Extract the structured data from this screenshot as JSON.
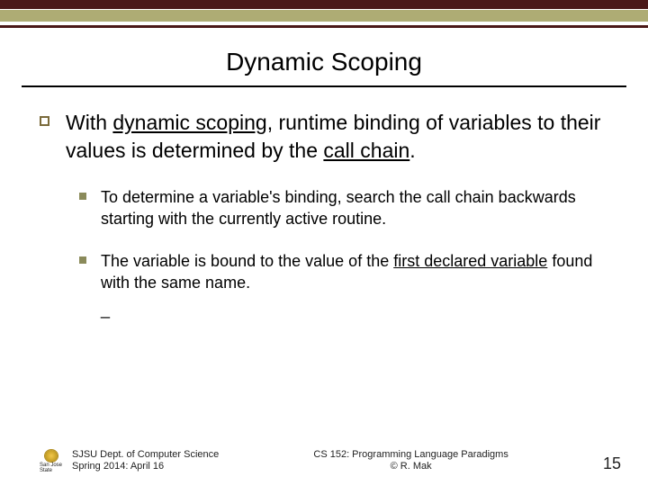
{
  "title": "Dynamic Scoping",
  "bullets": {
    "main": {
      "pre": "With ",
      "u1": "dynamic scoping",
      "mid": ", runtime binding of variables to their values is determined by the ",
      "u2": "call chain",
      "post": "."
    },
    "sub1": "To determine a variable's binding, search the call chain backwards starting with the currently active routine.",
    "sub2": {
      "pre": "The variable is bound to the value of the ",
      "u": "first declared variable",
      "post": " found with the same name.",
      "trail": "_"
    }
  },
  "footer": {
    "logo_text": "San Jose State",
    "left_line1": "SJSU Dept. of Computer Science",
    "left_line2": "Spring 2014: April 16",
    "center_line1": "CS 152: Programming Language Paradigms",
    "center_line2": "© R. Mak",
    "page": "15"
  }
}
